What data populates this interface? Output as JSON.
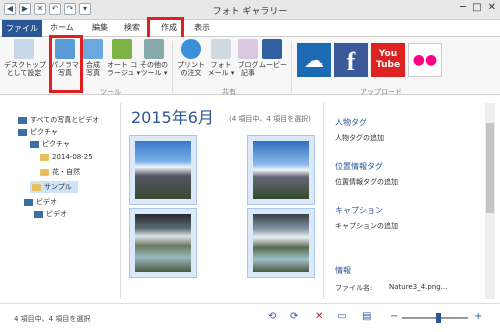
{
  "window": {
    "title": "フォト ギャラリー",
    "qat": [
      "◀",
      "▶",
      "✕",
      "↶",
      "↷",
      "▾"
    ],
    "controls": [
      "─",
      "□",
      "✕"
    ]
  },
  "tabs": [
    "ファイル",
    "ホーム",
    "編集",
    "検索",
    "作成",
    "表示"
  ],
  "ribbon": {
    "buttons": [
      {
        "label": "デスクトップ\nとして設定",
        "icon": "desktop-icon"
      },
      {
        "label": "パノラマ\n写真",
        "icon": "panorama-icon"
      },
      {
        "label": "合成\n写真",
        "icon": "photo-fuse-icon"
      },
      {
        "label": "オート コ\nラージュ ▾",
        "icon": "collage-icon"
      },
      {
        "label": "その他の\nツール ▾",
        "icon": "tools-icon"
      },
      {
        "label": "プリント\nの注文",
        "icon": "print-icon"
      },
      {
        "label": "フォト\nメール ▾",
        "icon": "mail-icon"
      },
      {
        "label": "ブログ\n記事",
        "icon": "blog-icon"
      },
      {
        "label": "ムービー",
        "icon": "movie-icon"
      }
    ],
    "groups": [
      "ツール",
      "共有",
      "アップロード"
    ],
    "social": [
      {
        "name": "onedrive-icon",
        "label": "☁",
        "color": "#1c6ab3"
      },
      {
        "name": "facebook-icon",
        "label": "f",
        "color": "#3b5998"
      },
      {
        "name": "youtube-icon",
        "label": "You\nTube",
        "color": "#dd2222"
      },
      {
        "name": "flickr-icon",
        "label": "●●",
        "color": "#ffffff"
      }
    ]
  },
  "tree": [
    {
      "label": "すべての写真とビデオ",
      "type": "pc"
    },
    {
      "label": "ピクチャ",
      "type": "pc"
    },
    {
      "label": "ピクチャ",
      "type": "pc"
    },
    {
      "label": "2014-08-25",
      "type": "folder"
    },
    {
      "label": "花・自然",
      "type": "folder"
    },
    {
      "label": "サンプル",
      "type": "folder"
    },
    {
      "label": "ビデオ",
      "type": "pc"
    },
    {
      "label": "ビデオ",
      "type": "pc"
    }
  ],
  "main": {
    "date_title": "2015年6月",
    "subtitle": "(4 項目中、4 項目を選択)"
  },
  "details": {
    "people_tag": "人物タグ",
    "people_add": "人物タグの追加",
    "geo_tag": "位置情報タグ",
    "geo_add": "位置情報タグの追加",
    "caption": "キャプション",
    "caption_add": "キャプションの追加",
    "info": "情報",
    "filename_label": "ファイル名:",
    "filename_value": "Nature3_4.png..."
  },
  "status": {
    "text": "4 項目中、4 項目を選択",
    "icons": [
      "⟲",
      "⟳",
      "✕",
      "▭",
      "−",
      "+"
    ],
    "zoom_level": 0.55
  }
}
